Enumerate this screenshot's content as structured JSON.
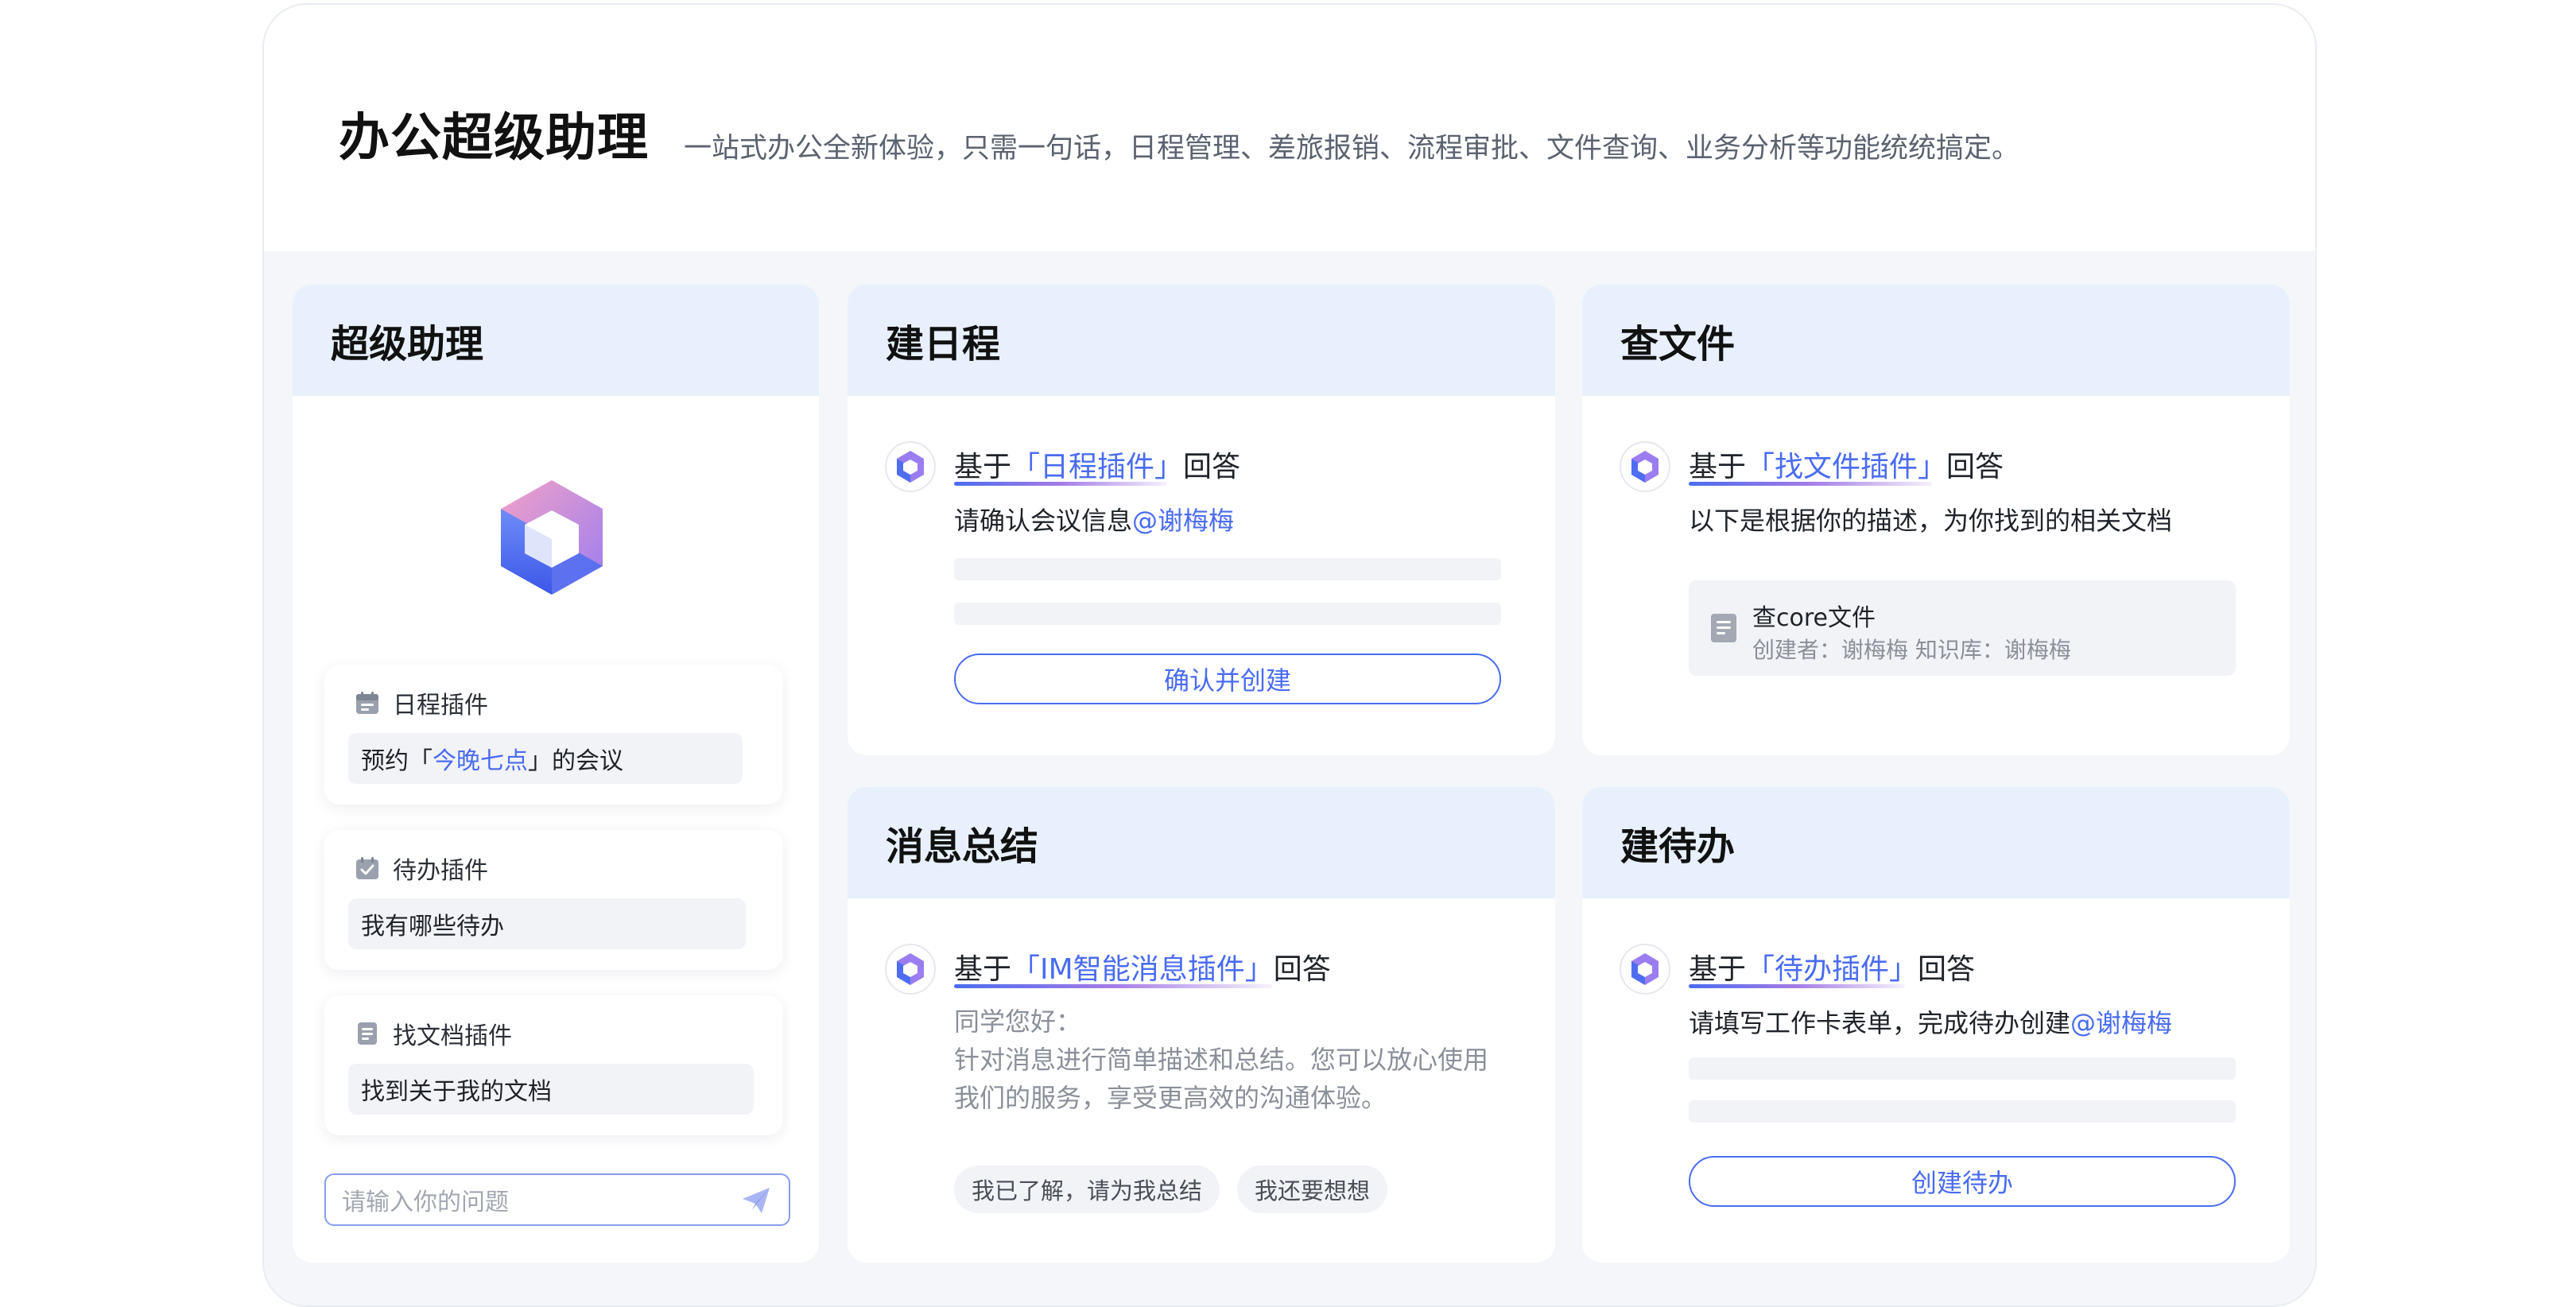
{
  "hero": {
    "title": "办公超级助理",
    "subtitle": "一站式办公全新体验，只需一句话，日程管理、差旅报销、流程审批、文件查询、业务分析等功能统统搞定。"
  },
  "super_assistant": {
    "title": "超级助理",
    "logo_icon": "hexagon-logo-icon",
    "plugins": [
      {
        "icon": "calendar-icon",
        "name": "日程插件",
        "query_prefix": "预约「",
        "query_highlight": "今晚七点",
        "query_suffix": "」的会议"
      },
      {
        "icon": "todo-check-icon",
        "name": "待办插件",
        "query_prefix": "我有哪些待办",
        "query_highlight": "",
        "query_suffix": ""
      },
      {
        "icon": "document-icon",
        "name": "找文档插件",
        "query_prefix": "找到关于我的文档",
        "query_highlight": "",
        "query_suffix": ""
      }
    ],
    "input_placeholder": "请输入你的问题",
    "send_icon": "paper-plane-icon"
  },
  "schedule": {
    "title": "建日程",
    "reply_prefix": "基于",
    "plugin": "「日程插件」",
    "reply_suffix": "回答",
    "message": "请确认会议信息",
    "mention": "@谢梅梅",
    "button": "确认并创建"
  },
  "files": {
    "title": "查文件",
    "reply_prefix": "基于",
    "plugin": "「找文件插件」",
    "reply_suffix": "回答",
    "message": "以下是根据你的描述，为你找到的相关文档",
    "file_name": "查core文件",
    "file_meta": "创建者：谢梅梅    知识库：谢梅梅"
  },
  "summary": {
    "title": "消息总结",
    "reply_prefix": "基于",
    "plugin": "「IM智能消息插件」",
    "reply_suffix": "回答",
    "greeting": "同学您好：",
    "line1": "针对消息进行简单描述和总结。您可以放心使用",
    "line2": "我们的服务，享受更高效的沟通体验。",
    "chip1": "我已了解，请为我总结",
    "chip2": "我还要想想"
  },
  "todo": {
    "title": "建待办",
    "reply_prefix": "基于",
    "plugin": "「待办插件」",
    "reply_suffix": "回答",
    "message": "请填写工作卡表单，完成待办创建",
    "mention": "@谢梅梅",
    "button": "创建待办"
  },
  "colors": {
    "accent": "#4a6cf0",
    "header_bg": "#e8f0fd",
    "page_bg": "#f4f6f9"
  }
}
